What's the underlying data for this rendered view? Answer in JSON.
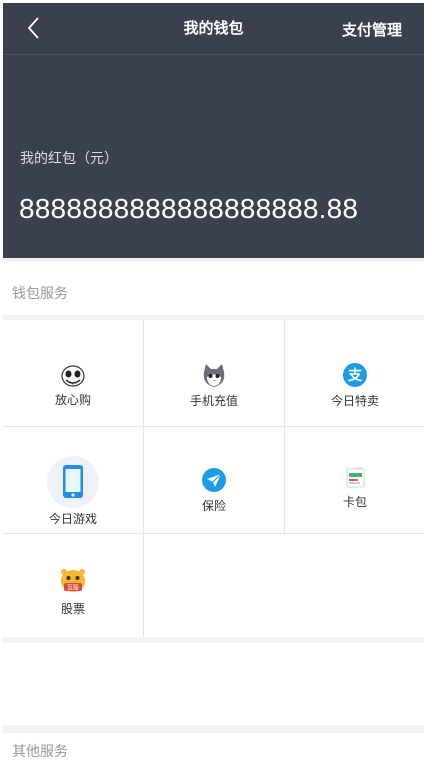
{
  "header": {
    "title": "我的钱包",
    "right_action": "支付管理",
    "back_icon": "chevron-left-icon"
  },
  "balance": {
    "label": "我的红包（元）",
    "amount": "8888888888888888888.88"
  },
  "sections": {
    "wallet_services": "钱包服务",
    "other_services": "其他服务"
  },
  "services": [
    {
      "label": "放心购",
      "icon": "skull-mascot-icon"
    },
    {
      "label": "手机充值",
      "icon": "cat-mascot-icon"
    },
    {
      "label": "今日特卖",
      "icon": "alipay-icon"
    },
    {
      "label": "今日游戏",
      "icon": "phone-icon"
    },
    {
      "label": "保险",
      "icon": "paper-plane-icon"
    },
    {
      "label": "卡包",
      "icon": "card-pack-icon"
    },
    {
      "label": "股票",
      "icon": "stock-mascot-icon"
    }
  ],
  "stock_badge": "互股",
  "colors": {
    "header_bg": "#3b404e",
    "accent_blue": "#1e9be6",
    "section_text": "#999999"
  }
}
